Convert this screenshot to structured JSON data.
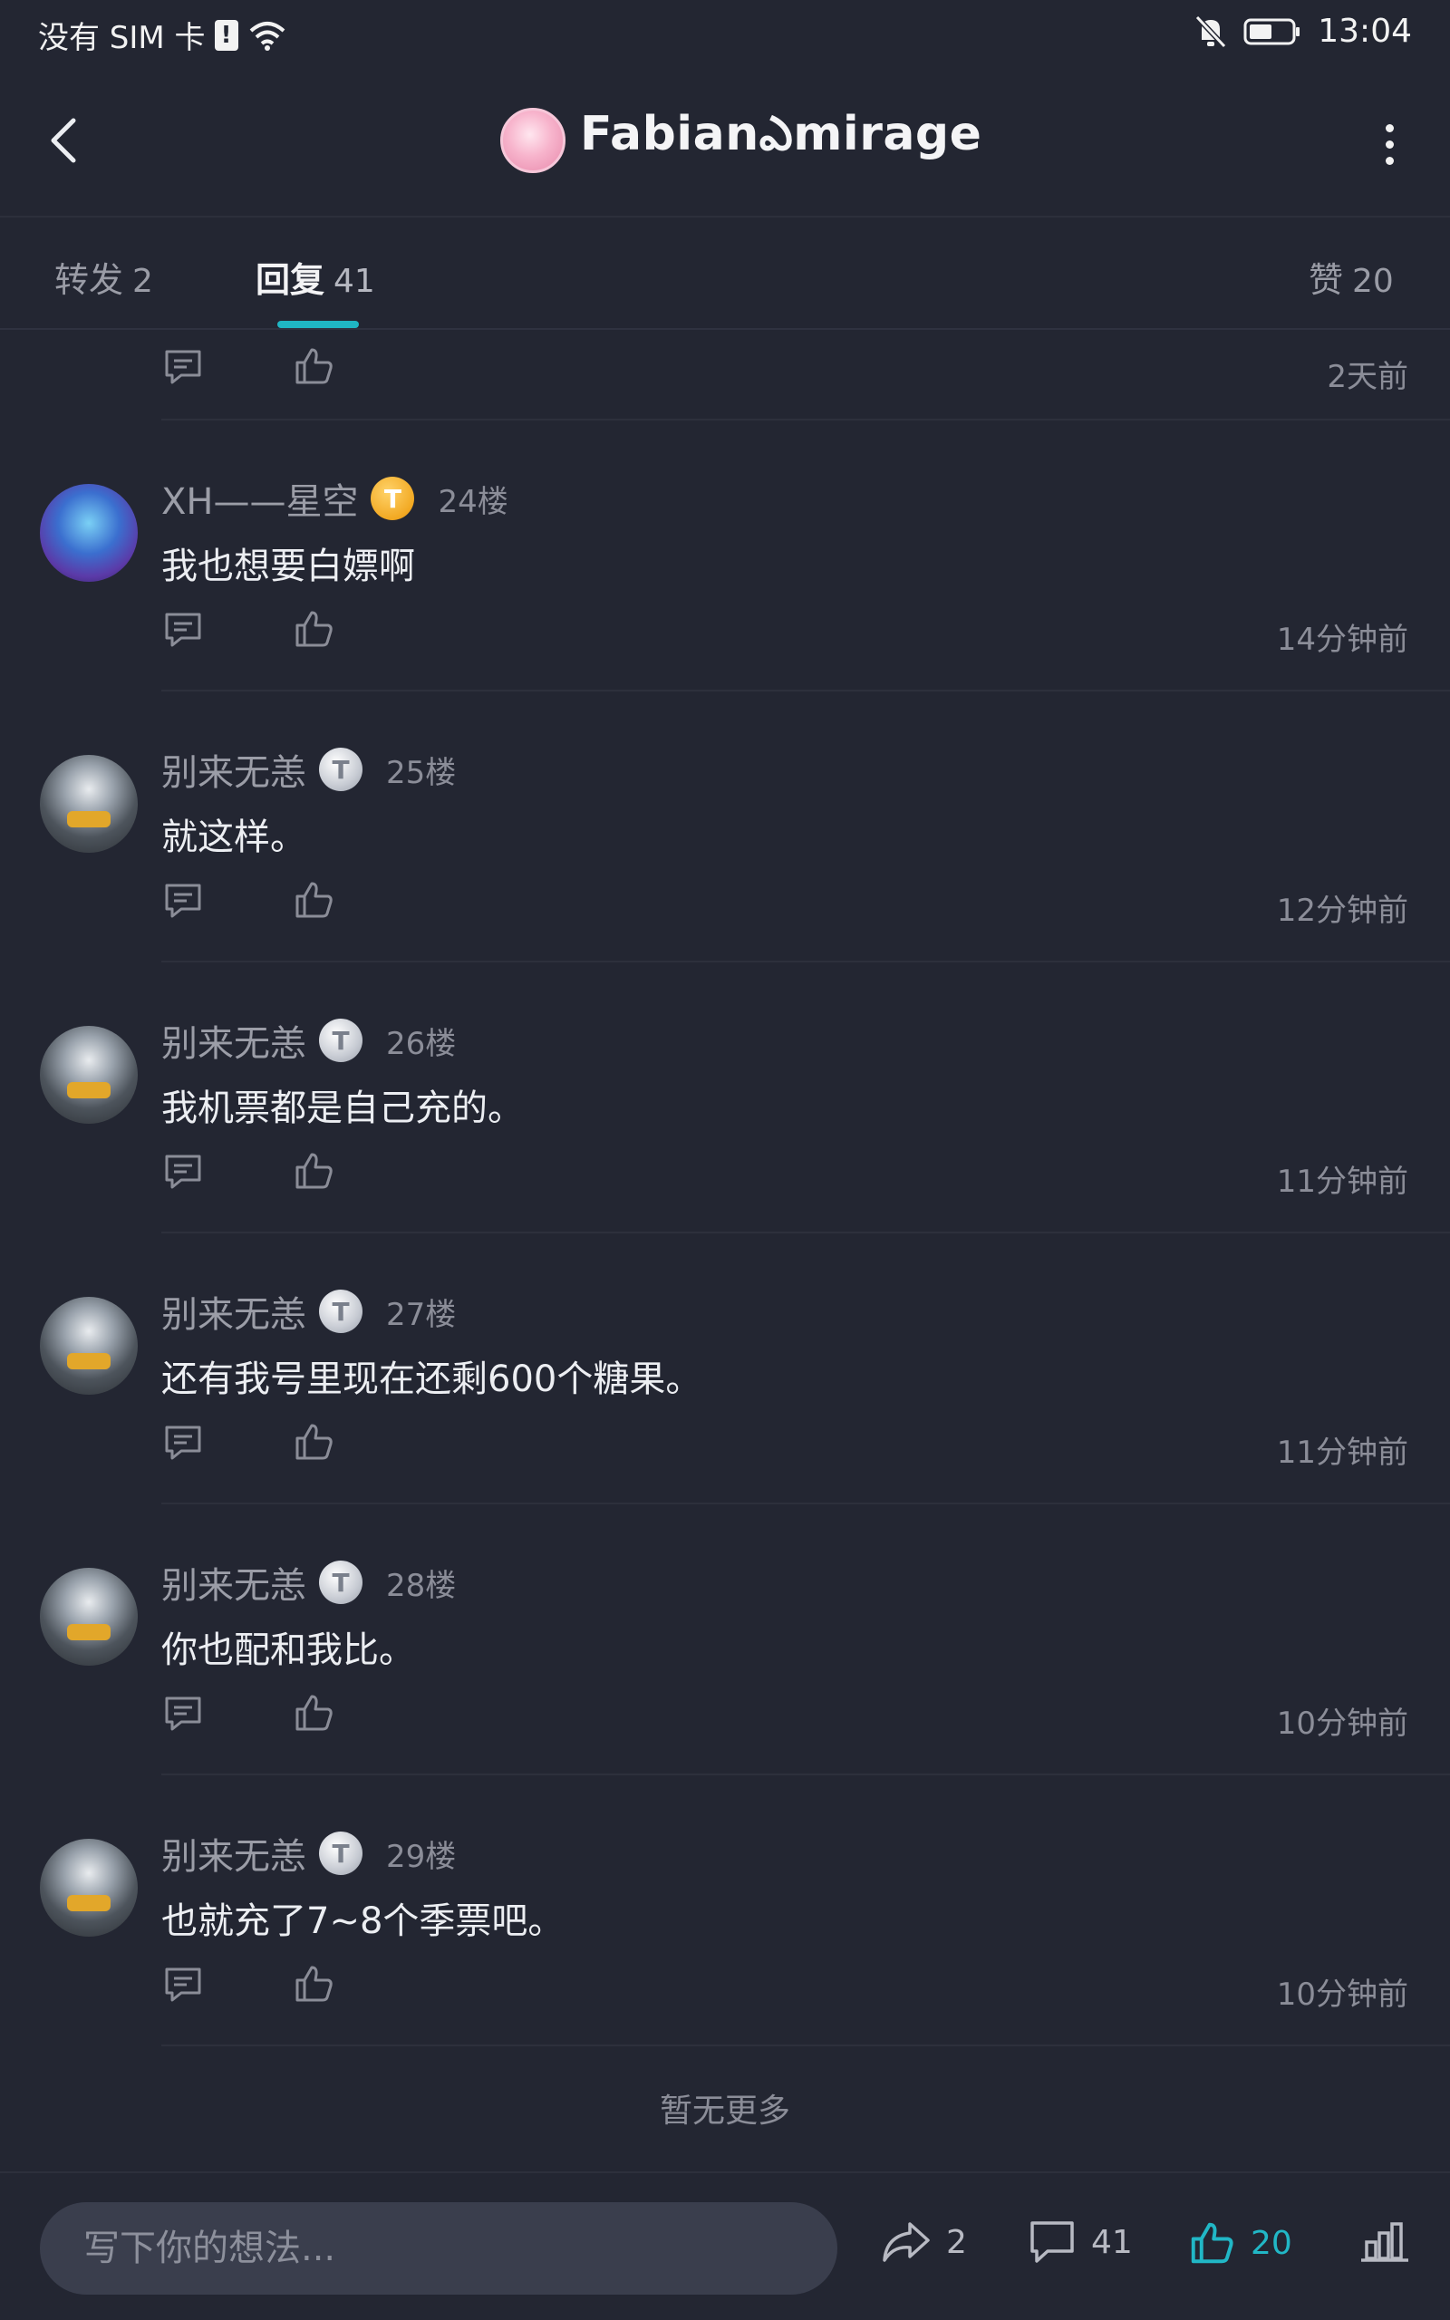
{
  "status_bar": {
    "sim": "没有 SIM 卡",
    "time": "13:04"
  },
  "header": {
    "title": "Fabianఎmirage"
  },
  "tabs": [
    {
      "label": "转发",
      "count": "2"
    },
    {
      "label": "回复",
      "count": "41"
    },
    {
      "label": "赞",
      "count": "20"
    }
  ],
  "partial_row": {
    "time": "2天前"
  },
  "comments": [
    {
      "name": "XH——星空",
      "badge": "T",
      "floor": "24楼",
      "text": "我也想要白嫖啊",
      "time": "14分钟前"
    },
    {
      "name": "别来无恙",
      "badge": "T",
      "floor": "25楼",
      "text": "就这样。",
      "time": "12分钟前"
    },
    {
      "name": "别来无恙",
      "badge": "T",
      "floor": "26楼",
      "text": "我机票都是自己充的。",
      "time": "11分钟前"
    },
    {
      "name": "别来无恙",
      "badge": "T",
      "floor": "27楼",
      "text": "还有我号里现在还剩600个糖果。",
      "time": "11分钟前"
    },
    {
      "name": "别来无恙",
      "badge": "T",
      "floor": "28楼",
      "text": "你也配和我比。",
      "time": "10分钟前"
    },
    {
      "name": "别来无恙",
      "badge": "T",
      "floor": "29楼",
      "text": "也就充了7~8个季票吧。",
      "time": "10分钟前"
    }
  ],
  "no_more": "暂无更多",
  "bottom_bar": {
    "input_placeholder": "写下你的想法...",
    "forward_count": "2",
    "comment_count": "41",
    "like_count": "20"
  },
  "colors": {
    "accent": "#1fb6c4",
    "background": "#232632"
  },
  "icons": [
    "back-arrow-icon",
    "more-vertical-icon",
    "comment-icon",
    "thumb-up-icon",
    "share-icon",
    "stats-icon"
  ]
}
